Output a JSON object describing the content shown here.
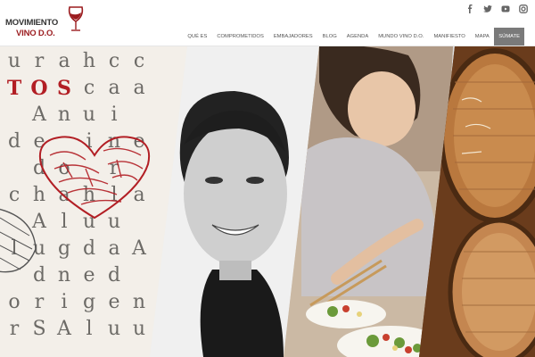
{
  "brand": {
    "line1": "MOVIMIENTO",
    "line2": "VINO D.O."
  },
  "social": {
    "icons": [
      "facebook-icon",
      "twitter-icon",
      "youtube-icon",
      "instagram-icon"
    ]
  },
  "nav": {
    "items": [
      {
        "label": "QUÉ ES"
      },
      {
        "label": "COMPROMETIDOS"
      },
      {
        "label": "EMBAJADORES"
      },
      {
        "label": "BLOG"
      },
      {
        "label": "AGENDA"
      },
      {
        "label": "MUNDO VINO D.O."
      },
      {
        "label": "MANIFIESTO"
      },
      {
        "label": "MAPA"
      },
      {
        "label": "SÚMATE"
      }
    ]
  },
  "hero": {
    "letter_rows": [
      [
        "u",
        "r",
        "a",
        "h",
        "c",
        "c"
      ],
      [
        "T",
        "O",
        "S",
        "c",
        "a",
        "a"
      ],
      [
        "",
        "A",
        "n",
        "u",
        "i",
        ""
      ],
      [
        "d",
        "e",
        "",
        "i",
        "n",
        "e"
      ],
      [
        "",
        "d",
        "o",
        "",
        "r",
        ""
      ],
      [
        "c",
        "h",
        "a",
        "h",
        "l",
        "a"
      ],
      [
        "",
        "A",
        "l",
        "u",
        "u",
        ""
      ],
      [
        "l",
        "u",
        "g",
        "d",
        "a",
        "A"
      ],
      [
        "",
        "d",
        "n",
        "e",
        "d",
        ""
      ],
      [
        "o",
        "r",
        "i",
        "g",
        "e",
        "n"
      ],
      [
        "r",
        "S",
        "A",
        "l",
        "u",
        "u"
      ]
    ],
    "colors": {
      "brand_red": "#b21e24",
      "nav_cta_bg": "#7a7a7a"
    }
  }
}
